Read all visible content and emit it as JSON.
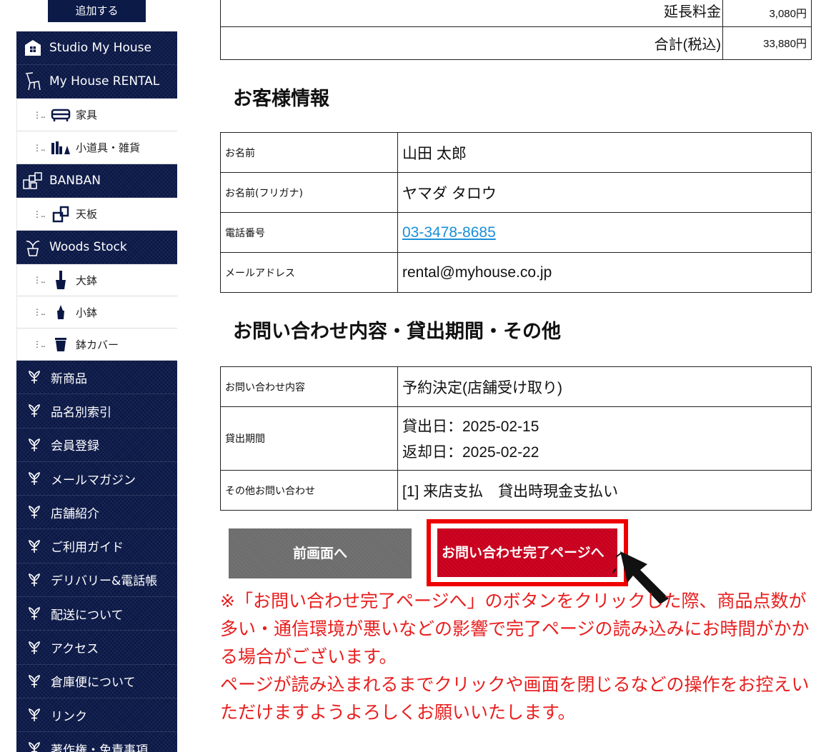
{
  "sidebar": {
    "add_label": "追加する",
    "categories": [
      {
        "label": "Studio My House",
        "icon": "house-icon"
      },
      {
        "label": "My House RENTAL",
        "icon": "chair-icon"
      }
    ],
    "rental_items": [
      {
        "label": "家具",
        "icon": "sofa-icon"
      },
      {
        "label": "小道具・雑貨",
        "icon": "props-icon"
      }
    ],
    "banban": {
      "label": "BANBAN",
      "icon": "blocks-icon"
    },
    "banban_items": [
      {
        "label": "天板",
        "icon": "table-top-icon"
      }
    ],
    "woods": {
      "label": "Woods Stock",
      "icon": "plant-icon"
    },
    "woods_items": [
      {
        "label": "大鉢",
        "icon": "large-pot-icon"
      },
      {
        "label": "小鉢",
        "icon": "small-pot-icon"
      },
      {
        "label": "鉢カバー",
        "icon": "pot-cover-icon"
      }
    ],
    "menu": [
      "新商品",
      "品名別索引",
      "会員登録",
      "メールマガジン",
      "店舗紹介",
      "ご利用ガイド",
      "デリバリー&電話帳",
      "配送について",
      "アクセス",
      "倉庫便について",
      "リンク",
      "著作権・免責事項"
    ]
  },
  "price_rows": [
    {
      "label": "延長料金",
      "value": "3,080円"
    },
    {
      "label": "合計(税込)",
      "value": "33,880円"
    }
  ],
  "customer": {
    "title": "お客様情報",
    "rows": [
      {
        "key": "お名前",
        "value": "山田 太郎"
      },
      {
        "key": "お名前(フリガナ)",
        "value": "ヤマダ タロウ"
      },
      {
        "key": "電話番号",
        "value": "03-3478-8685"
      },
      {
        "key": "メールアドレス",
        "value": "rental@myhouse.co.jp"
      }
    ]
  },
  "inquiry": {
    "title": "お問い合わせ内容・貸出期間・その他",
    "rows": [
      {
        "key": "お問い合わせ内容",
        "value": "予約決定(店舗受け取り)"
      },
      {
        "key": "貸出期間",
        "value_line1": "貸出日：2025-02-15",
        "value_line2": "返却日：2025-02-22"
      },
      {
        "key": "その他お問い合わせ",
        "value": "[1] 来店支払　貸出時現金支払い"
      }
    ]
  },
  "buttons": {
    "back": "前画面へ",
    "complete": "お問い合わせ完了ページへ"
  },
  "notice": {
    "line1": "※「お問い合わせ完了ページへ」のボタンをクリックした際、商品点数が多い・通信環境が悪いなどの影響で完了ページの読み込みにお時間がかかる場合がございます。",
    "line2": "ページが読み込まれるまでクリックや画面を閉じるなどの操作をお控えいただけますようよろしくお願いいたします。"
  },
  "colors": {
    "navy": "#0b1846",
    "red": "#c8001e",
    "highlight": "#ee0000",
    "notice": "#e81e1e",
    "link": "#1a8fd8"
  }
}
